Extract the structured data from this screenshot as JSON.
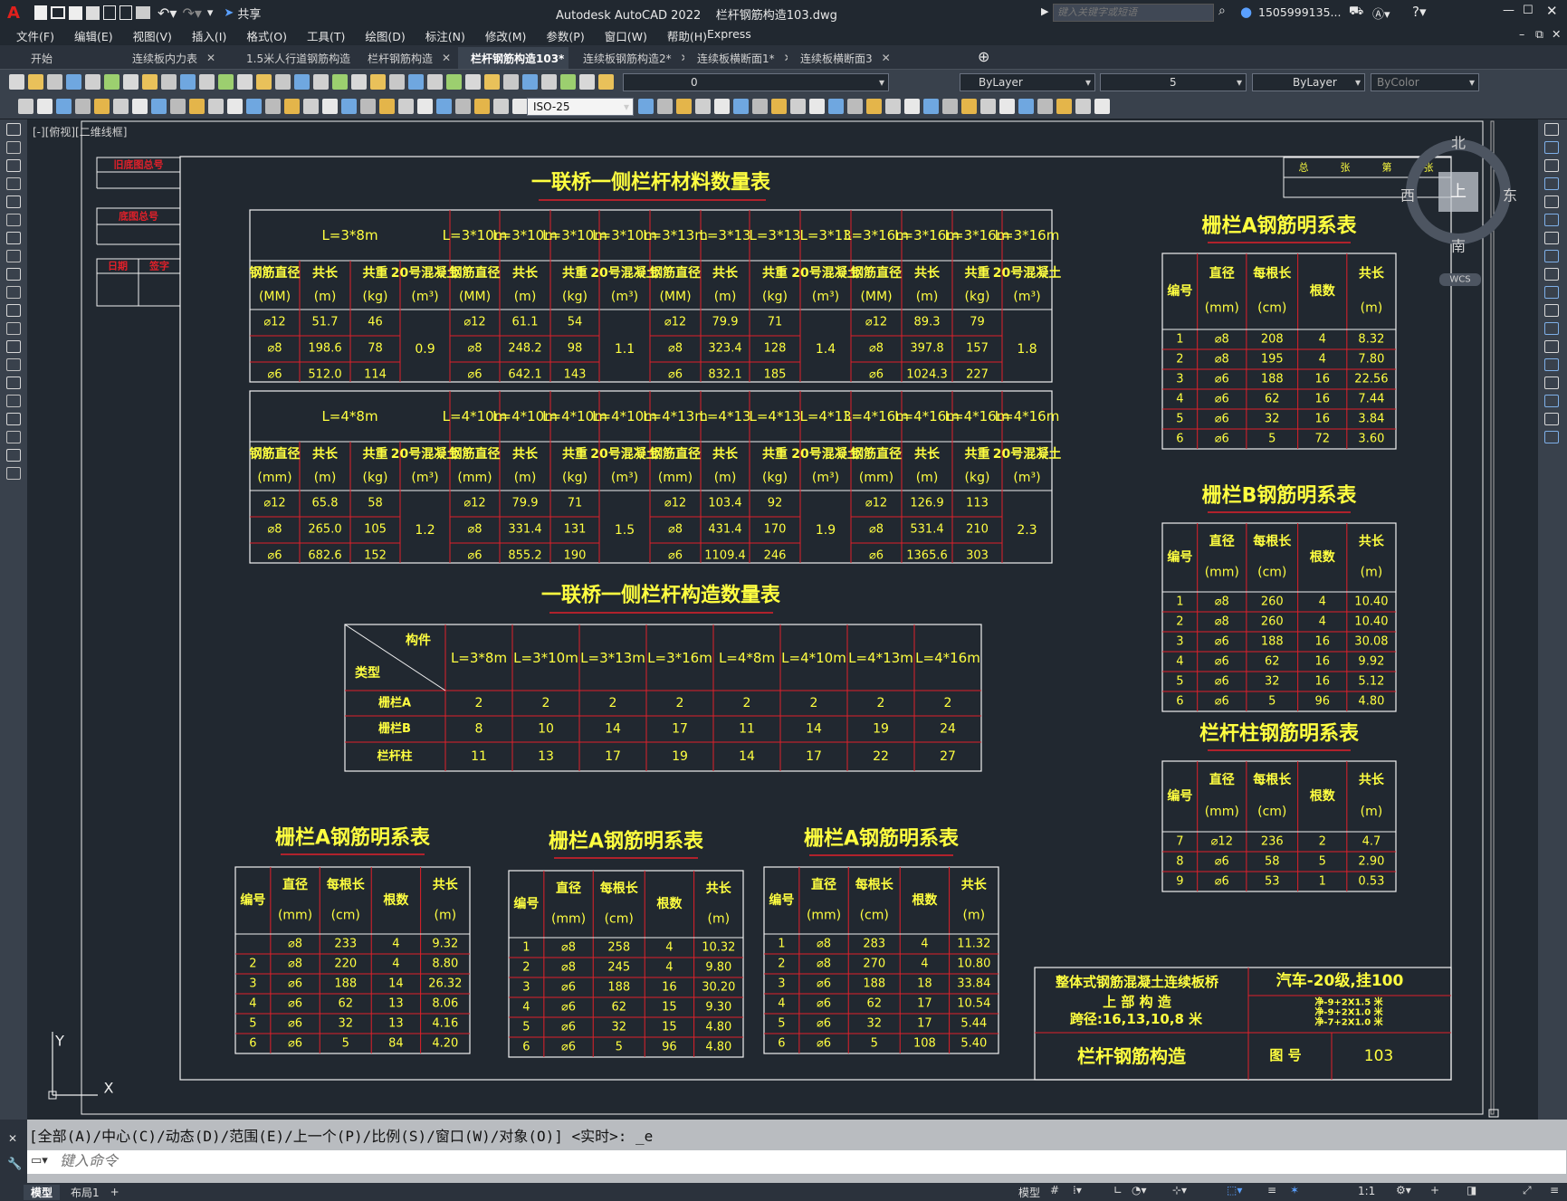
{
  "app": {
    "title": "Autodesk AutoCAD 2022",
    "file": "栏杆钢筋构造103.dwg",
    "share": "共享",
    "search_placeholder": "键入关键字或短语",
    "user": "1505999135...",
    "logo": "A"
  },
  "menu": [
    "文件(F)",
    "编辑(E)",
    "视图(V)",
    "插入(I)",
    "格式(O)",
    "工具(T)",
    "绘图(D)",
    "标注(N)",
    "修改(M)",
    "参数(P)",
    "窗口(W)",
    "帮助(H)",
    "Express"
  ],
  "tabs": [
    {
      "label": "开始"
    },
    {
      "label": "连续板内力表"
    },
    {
      "label": "1.5米人行道钢筋构造"
    },
    {
      "label": "栏杆钢筋构造"
    },
    {
      "label": "栏杆钢筋构造103*",
      "active": true
    },
    {
      "label": "连续板钢筋构造2*"
    },
    {
      "label": "连续板横断面1*"
    },
    {
      "label": "连续板横断面3"
    }
  ],
  "props": {
    "layer": "0",
    "color": "ByLayer",
    "linetype": "5",
    "lineweight": "ByLayer",
    "plotstyle": "ByColor",
    "dimstyle": "ISO-25"
  },
  "viewport_label": "[-][俯视][二维线框]",
  "viewcube": {
    "n": "北",
    "s": "南",
    "e": "东",
    "w": "西",
    "top": "上",
    "wcs": "WCS"
  },
  "ucs": {
    "x": "X",
    "y": "Y"
  },
  "sidebar_labels": [
    "旧底图总号",
    "底图总号",
    "日期",
    "签字"
  ],
  "corner_labels": [
    "总",
    "张",
    "第",
    "张"
  ],
  "table1": {
    "title": "一联桥一侧栏杆材料数量表",
    "groups": [
      {
        "spans": [
          "L=3*8m",
          "L=3*10m",
          "L=3*10m",
          "L=3*10m",
          "L=3*10m",
          "L=3*13m",
          "L=3*13",
          "L=3*13",
          "L=3*13",
          "L=3*16m",
          "L=3*16m",
          "L=3*16m",
          "L=3*16m"
        ],
        "headers": [
          [
            "钢筋直径",
            "(MM)"
          ],
          [
            "共长",
            "(m)"
          ],
          [
            "共重",
            "(kg)"
          ],
          [
            "20号混凝土",
            "(m³)"
          ]
        ],
        "blocks": [
          {
            "rows": [
              [
                "⌀12",
                "51.7",
                "46"
              ],
              [
                "⌀8",
                "198.6",
                "78"
              ],
              [
                "⌀6",
                "512.0",
                "114"
              ]
            ],
            "concrete": "0.9"
          },
          {
            "rows": [
              [
                "⌀12",
                "61.1",
                "54"
              ],
              [
                "⌀8",
                "248.2",
                "98"
              ],
              [
                "⌀6",
                "642.1",
                "143"
              ]
            ],
            "concrete": "1.1"
          },
          {
            "rows": [
              [
                "⌀12",
                "79.9",
                "71"
              ],
              [
                "⌀8",
                "323.4",
                "128"
              ],
              [
                "⌀6",
                "832.1",
                "185"
              ]
            ],
            "concrete": "1.4"
          },
          {
            "rows": [
              [
                "⌀12",
                "89.3",
                "79"
              ],
              [
                "⌀8",
                "397.8",
                "157"
              ],
              [
                "⌀6",
                "1024.3",
                "227"
              ]
            ],
            "concrete": "1.8"
          }
        ]
      },
      {
        "spans": [
          "L=4*8m",
          "L=4*10m",
          "L=4*10m",
          "L=4*10m",
          "L=4*10m",
          "L=4*13m",
          "L=4*13",
          "L=4*13",
          "L=4*13",
          "L=4*16m",
          "L=4*16m",
          "L=4*16m",
          "L=4*16m"
        ],
        "headers": [
          [
            "钢筋直径",
            "(mm)"
          ],
          [
            "共长",
            "(m)"
          ],
          [
            "共重",
            "(kg)"
          ],
          [
            "20号混凝土",
            "(m³)"
          ]
        ],
        "blocks": [
          {
            "rows": [
              [
                "⌀12",
                "65.8",
                "58"
              ],
              [
                "⌀8",
                "265.0",
                "105"
              ],
              [
                "⌀6",
                "682.6",
                "152"
              ]
            ],
            "concrete": "1.2"
          },
          {
            "rows": [
              [
                "⌀12",
                "79.9",
                "71"
              ],
              [
                "⌀8",
                "331.4",
                "131"
              ],
              [
                "⌀6",
                "855.2",
                "190"
              ]
            ],
            "concrete": "1.5"
          },
          {
            "rows": [
              [
                "⌀12",
                "103.4",
                "92"
              ],
              [
                "⌀8",
                "431.4",
                "170"
              ],
              [
                "⌀6",
                "1109.4",
                "246"
              ]
            ],
            "concrete": "1.9"
          },
          {
            "rows": [
              [
                "⌀12",
                "126.9",
                "113"
              ],
              [
                "⌀8",
                "531.4",
                "210"
              ],
              [
                "⌀6",
                "1365.6",
                "303"
              ]
            ],
            "concrete": "2.3"
          }
        ]
      }
    ]
  },
  "table2": {
    "title": "一联桥一侧栏杆构造数量表",
    "corner_top": "构件",
    "corner_bottom": "类型",
    "cols": [
      "L=3*8m",
      "L=3*10m",
      "L=3*13m",
      "L=3*16m",
      "L=4*8m",
      "L=4*10m",
      "L=4*13m",
      "L=4*16m"
    ],
    "rows": [
      {
        "label": "栅栏A",
        "values": [
          "2",
          "2",
          "2",
          "2",
          "2",
          "2",
          "2",
          "2"
        ]
      },
      {
        "label": "栅栏B",
        "values": [
          "8",
          "10",
          "14",
          "17",
          "11",
          "14",
          "19",
          "24"
        ]
      },
      {
        "label": "栏杆柱",
        "values": [
          "11",
          "13",
          "17",
          "19",
          "14",
          "17",
          "22",
          "27"
        ]
      }
    ]
  },
  "rebar_headers": [
    [
      "编号",
      ""
    ],
    [
      "直径",
      "(mm)"
    ],
    [
      "每根长",
      "(cm)"
    ],
    [
      "根数",
      ""
    ],
    [
      "共长",
      "(m)"
    ]
  ],
  "rebar_tables": [
    {
      "title": "栅栏A钢筋明系表",
      "rows": [
        [
          "1",
          "⌀8",
          "208",
          "4",
          "8.32"
        ],
        [
          "2",
          "⌀8",
          "195",
          "4",
          "7.80"
        ],
        [
          "3",
          "⌀6",
          "188",
          "16",
          "22.56"
        ],
        [
          "4",
          "⌀6",
          "62",
          "16",
          "7.44"
        ],
        [
          "5",
          "⌀6",
          "32",
          "16",
          "3.84"
        ],
        [
          "6",
          "⌀6",
          "5",
          "72",
          "3.60"
        ]
      ]
    },
    {
      "title": "栅栏B钢筋明系表",
      "rows": [
        [
          "1",
          "⌀8",
          "260",
          "4",
          "10.40"
        ],
        [
          "2",
          "⌀8",
          "260",
          "4",
          "10.40"
        ],
        [
          "3",
          "⌀6",
          "188",
          "16",
          "30.08"
        ],
        [
          "4",
          "⌀6",
          "62",
          "16",
          "9.92"
        ],
        [
          "5",
          "⌀6",
          "32",
          "16",
          "5.12"
        ],
        [
          "6",
          "⌀6",
          "5",
          "96",
          "4.80"
        ]
      ]
    },
    {
      "title": "栏杆柱钢筋明系表",
      "rows": [
        [
          "7",
          "⌀12",
          "236",
          "2",
          "4.7"
        ],
        [
          "8",
          "⌀6",
          "58",
          "5",
          "2.90"
        ],
        [
          "9",
          "⌀6",
          "53",
          "1",
          "0.53"
        ]
      ]
    },
    {
      "title": "栅栏A钢筋明系表",
      "rows": [
        [
          "",
          "⌀8",
          "233",
          "4",
          "9.32"
        ],
        [
          "2",
          "⌀8",
          "220",
          "4",
          "8.80"
        ],
        [
          "3",
          "⌀6",
          "188",
          "14",
          "26.32"
        ],
        [
          "4",
          "⌀6",
          "62",
          "13",
          "8.06"
        ],
        [
          "5",
          "⌀6",
          "32",
          "13",
          "4.16"
        ],
        [
          "6",
          "⌀6",
          "5",
          "84",
          "4.20"
        ]
      ]
    },
    {
      "title": "栅栏A钢筋明系表",
      "rows": [
        [
          "1",
          "⌀8",
          "258",
          "4",
          "10.32"
        ],
        [
          "2",
          "⌀8",
          "245",
          "4",
          "9.80"
        ],
        [
          "3",
          "⌀6",
          "188",
          "16",
          "30.20"
        ],
        [
          "4",
          "⌀6",
          "62",
          "15",
          "9.30"
        ],
        [
          "5",
          "⌀6",
          "32",
          "15",
          "4.80"
        ],
        [
          "6",
          "⌀6",
          "5",
          "96",
          "4.80"
        ]
      ]
    },
    {
      "title": "栅栏A钢筋明系表",
      "rows": [
        [
          "1",
          "⌀8",
          "283",
          "4",
          "11.32"
        ],
        [
          "2",
          "⌀8",
          "270",
          "4",
          "10.80"
        ],
        [
          "3",
          "⌀6",
          "188",
          "18",
          "33.84"
        ],
        [
          "4",
          "⌀6",
          "62",
          "17",
          "10.54"
        ],
        [
          "5",
          "⌀6",
          "32",
          "17",
          "5.44"
        ],
        [
          "6",
          "⌀6",
          "5",
          "108",
          "5.40"
        ]
      ]
    }
  ],
  "titleblock": {
    "line1": "整体式钢筋混凝土连续板桥",
    "line2": "上 部 构 造",
    "line3": "跨径:16,13,10,8 米",
    "load": "汽车-20级,挂100",
    "widths": [
      "净-9+2X1.5 米",
      "净-9+2X1.0 米",
      "净-7+2X1.0 米"
    ],
    "name": "栏杆钢筋构造",
    "fig_label": "图 号",
    "fig_no": "103"
  },
  "command": {
    "history": "[全部(A)/中心(C)/动态(D)/范围(E)/上一个(P)/比例(S)/窗口(W)/对象(O)] <实时>: _e",
    "placeholder": "键入命令"
  },
  "status": {
    "model": "模型",
    "layout": "布局1",
    "add": "+",
    "model_btn": "模型",
    "scale": "1:1"
  }
}
